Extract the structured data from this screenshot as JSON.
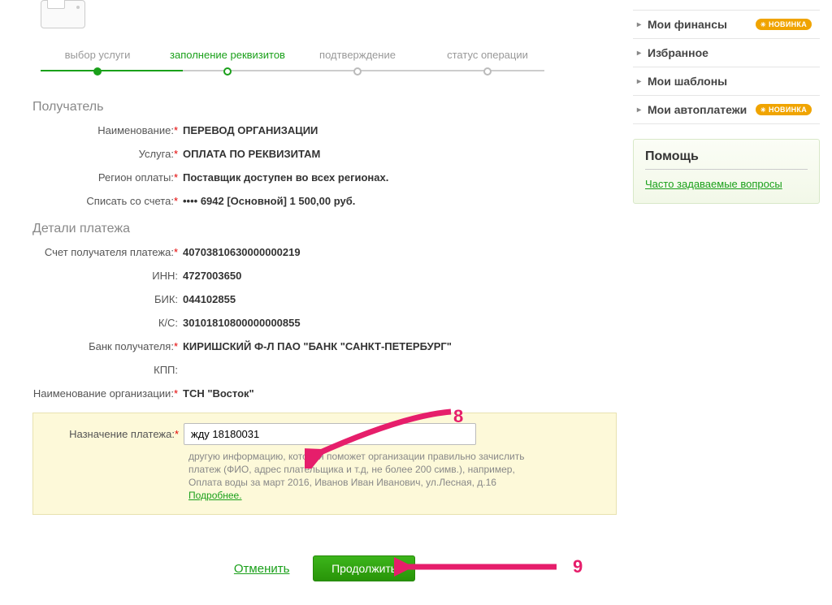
{
  "steps": [
    {
      "label": "выбор услуги",
      "state": "done"
    },
    {
      "label": "заполнение реквизитов",
      "state": "active"
    },
    {
      "label": "подтверждение",
      "state": ""
    },
    {
      "label": "статус операции",
      "state": ""
    }
  ],
  "section_recipient": "Получатель",
  "section_details": "Детали платежа",
  "fields": {
    "name_label": "Наименование:",
    "name_value": "ПЕРЕВОД ОРГАНИЗАЦИИ",
    "service_label": "Услуга:",
    "service_value": "ОПЛАТА ПО РЕКВИЗИТАМ",
    "region_label": "Регион оплаты:",
    "region_value": "Поставщик доступен во всех регионах.",
    "account_label": "Списать со счета:",
    "account_value": "•••• 6942  [Основной] 1 500,00   руб.",
    "recipient_acc_label": "Счет получателя платежа:",
    "recipient_acc_value": "40703810630000000219",
    "inn_label": "ИНН:",
    "inn_value": "4727003650",
    "bik_label": "БИК:",
    "bik_value": "044102855",
    "ks_label": "К/С:",
    "ks_value": "30101810800000000855",
    "bank_label": "Банк получателя:",
    "bank_value": "КИРИШСКИЙ Ф-Л ПАО \"БАНК \"САНКТ-ПЕТЕРБУРГ\"",
    "kpp_label": "КПП:",
    "kpp_value": "",
    "org_label": "Наименование организации:",
    "org_value": "ТСН \"Восток\"",
    "purpose_label": "Назначение платежа:",
    "purpose_value": "жду 18180031",
    "purpose_hint": "другую информацию, которая поможет организации правильно зачислить платеж (ФИО, адрес плательщика и т.д, не более 200 симв.), например, Оплата воды за март 2016, Иванов Иван Иванович, ул.Лесная, д.16 ",
    "purpose_more": "Подробнее."
  },
  "actions": {
    "cancel": "Отменить",
    "continue": "Продолжить"
  },
  "sidebar": {
    "items": [
      {
        "label": "Мои финансы",
        "badge": "НОВИНКА"
      },
      {
        "label": "Избранное",
        "badge": ""
      },
      {
        "label": "Мои шаблоны",
        "badge": ""
      },
      {
        "label": "Мои автоплатежи",
        "badge": "НОВИНКА"
      }
    ]
  },
  "help": {
    "title": "Помощь",
    "link": "Часто задаваемые вопросы"
  },
  "annotations": {
    "n8": "8",
    "n9": "9"
  }
}
